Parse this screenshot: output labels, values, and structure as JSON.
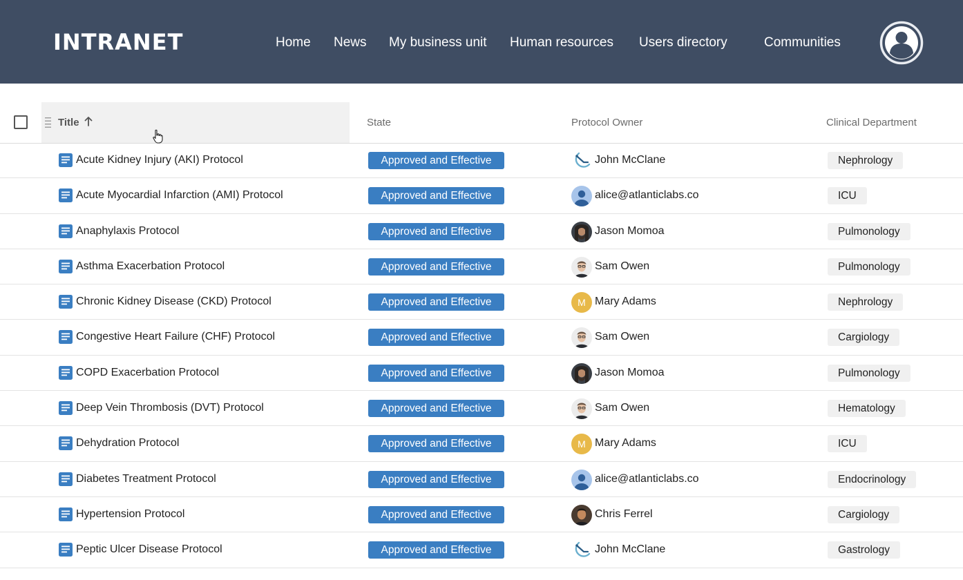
{
  "header": {
    "logo": "INTRANET",
    "nav": [
      "Home",
      "News",
      "My business unit",
      "Human resources",
      "Users directory",
      "Communities"
    ]
  },
  "table": {
    "columns": {
      "title": "Title",
      "state": "State",
      "owner": "Protocol Owner",
      "department": "Clinical Department"
    },
    "sort": {
      "column": "Title",
      "direction": "ascending"
    },
    "rows": [
      {
        "title": "Acute Kidney Injury (AKI) Protocol",
        "state": "Approved and Effective",
        "owner": "John McClane",
        "avatar": "logo",
        "department": "Nephrology"
      },
      {
        "title": "Acute Myocardial Infarction (AMI) Protocol",
        "state": "Approved and Effective",
        "owner": "alice@atlanticlabs.co",
        "avatar": "placeholder",
        "department": "ICU"
      },
      {
        "title": "Anaphylaxis Protocol",
        "state": "Approved and Effective",
        "owner": "Jason Momoa",
        "avatar": "photo-dark",
        "department": "Pulmonology"
      },
      {
        "title": "Asthma Exacerbation Protocol",
        "state": "Approved and Effective",
        "owner": "Sam Owen",
        "avatar": "photo-light",
        "department": "Pulmonology"
      },
      {
        "title": "Chronic Kidney Disease (CKD) Protocol",
        "state": "Approved and Effective",
        "owner": "Mary Adams",
        "avatar": "initial",
        "initial": "M",
        "department": "Nephrology"
      },
      {
        "title": "Congestive Heart Failure (CHF) Protocol",
        "state": "Approved and Effective",
        "owner": "Sam Owen",
        "avatar": "photo-light",
        "department": "Cargiology"
      },
      {
        "title": "COPD Exacerbation Protocol",
        "state": "Approved and Effective",
        "owner": "Jason Momoa",
        "avatar": "photo-dark",
        "department": "Pulmonology"
      },
      {
        "title": "Deep Vein Thrombosis (DVT) Protocol",
        "state": "Approved and Effective",
        "owner": "Sam Owen",
        "avatar": "photo-light",
        "department": "Hematology"
      },
      {
        "title": "Dehydration Protocol",
        "state": "Approved and Effective",
        "owner": "Mary Adams",
        "avatar": "initial",
        "initial": "M",
        "department": "ICU"
      },
      {
        "title": "Diabetes Treatment Protocol",
        "state": "Approved and Effective",
        "owner": "alice@atlanticlabs.co",
        "avatar": "placeholder",
        "department": "Endocrinology"
      },
      {
        "title": "Hypertension Protocol",
        "state": "Approved and Effective",
        "owner": "Chris Ferrel",
        "avatar": "photo-brown",
        "department": "Cargiology"
      },
      {
        "title": "Peptic Ulcer Disease Protocol",
        "state": "Approved and Effective",
        "owner": "John McClane",
        "avatar": "logo",
        "department": "Gastrology"
      }
    ]
  },
  "icons": {
    "profile": "user-circle-icon",
    "row": "document-icon",
    "sort": "arrow-up-icon",
    "grip": "drag-handle-icon",
    "pointer": "hand-cursor-icon"
  },
  "colors": {
    "header_bg": "#3f4d63",
    "state_badge": "#3a7ec2",
    "doc_icon": "#3a7ec2",
    "avatar_initial": "#e8b949",
    "avatar_placeholder": "#a7c4ea"
  }
}
